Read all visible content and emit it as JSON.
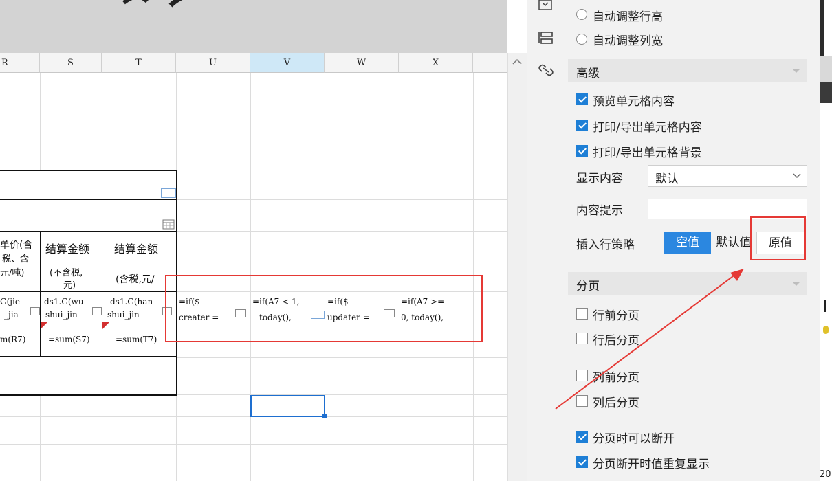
{
  "columns": {
    "r": "R",
    "s": "S",
    "t": "T",
    "u": "U",
    "v": "V",
    "w": "W",
    "x": "X"
  },
  "cells": {
    "r_header": "单价(含",
    "r_header2": "税、含",
    "r_header3": "元/吨)",
    "s_header": "结算金额",
    "s_header2": "(不含税,",
    "s_header3": "元)",
    "t_header": "结算金额",
    "t_header2": "(含税,元/",
    "r_row7a": "G(jie_",
    "r_row7b": "_jia",
    "s_row7a": "ds1.G(wu_",
    "s_row7b": "shui_jin",
    "t_row7a": "ds1.G(han_",
    "t_row7b": "shui_jin",
    "u_row7a": "=if($",
    "u_row7b": "creater =",
    "v_row7a": "=if(A7 < 1,",
    "v_row7b": "today(),",
    "w_row7a": "=if($",
    "w_row7b": "updater =",
    "x_row7a": "=if(A7 >=",
    "x_row7b": "0, today(),",
    "r_sum": "m(R7)",
    "s_sum": "=sum(S7)",
    "t_sum": "=sum(T7)"
  },
  "panel": {
    "auto_row_height": "自动调整行高",
    "auto_col_width": "自动调整列宽",
    "advanced_title": "高级",
    "preview_cell": "预览单元格内容",
    "print_export_content": "打印/导出单元格内容",
    "print_export_bg": "打印/导出单元格背景",
    "display_content_label": "显示内容",
    "display_content_value": "默认",
    "content_hint_label": "内容提示",
    "content_hint_value": "",
    "insert_row_policy_label": "插入行策略",
    "policy_options": [
      "空值",
      "默认值",
      "原值"
    ],
    "paging_title": "分页",
    "page_before_row": "行前分页",
    "page_after_row": "行后分页",
    "page_before_col": "列前分页",
    "page_after_col": "列后分页",
    "allow_break": "分页时可以断开",
    "repeat_on_break": "分页断开时值重复显示"
  },
  "edge_text": "20",
  "colors": {
    "accent": "#1e7fd6",
    "annotation_red": "#e53935",
    "selected_col": "#cfe8f7"
  }
}
